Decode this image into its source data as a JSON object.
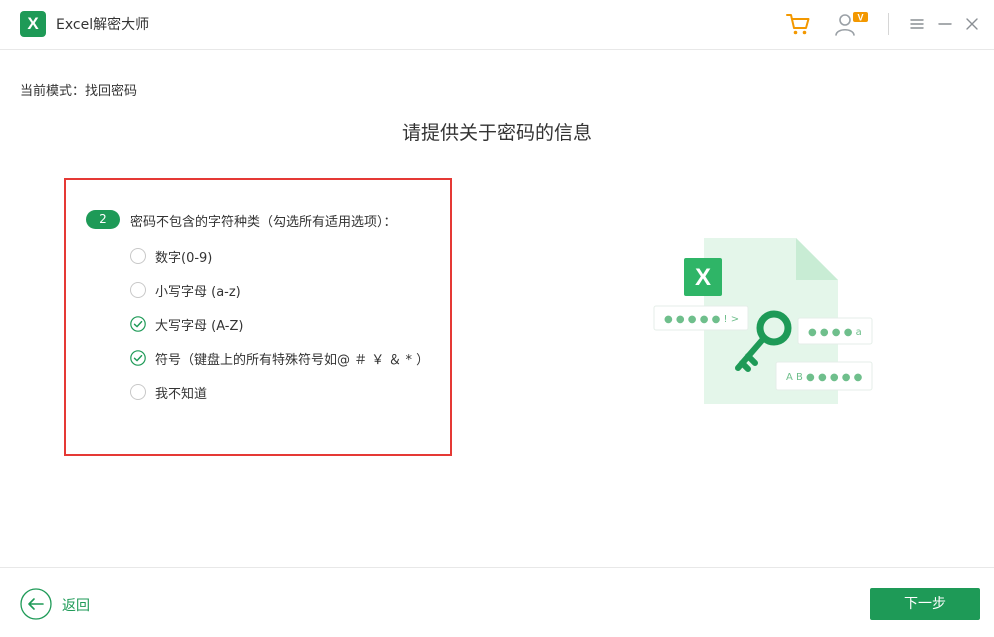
{
  "app": {
    "logo_letter": "X",
    "title": "Excel解密大师"
  },
  "titlebar": {
    "user_badge": "V"
  },
  "mode": {
    "label": "当前模式：找回密码"
  },
  "page": {
    "title": "请提供关于密码的信息"
  },
  "question": {
    "step": "2",
    "text": "密码不包含的字符种类（勾选所有适用选项）：",
    "options": [
      {
        "label": "数字(0-9)",
        "checked": false
      },
      {
        "label": "小写字母 (a-z)",
        "checked": false
      },
      {
        "label": "大写字母 (A-Z)",
        "checked": true
      },
      {
        "label": "符号（键盘上的所有特殊符号如@ ＃ ￥ ＆ * ）",
        "checked": true
      },
      {
        "label": "我不知道",
        "checked": false
      }
    ]
  },
  "illustration": {
    "doc_letter": "X",
    "card1": "● ● ● ● ●  ! >",
    "card2": "● ● ● ●  a",
    "card3": "A B ● ● ● ● ●"
  },
  "footer": {
    "back_label": "返回",
    "next_label": "下一步"
  },
  "colors": {
    "brand_green": "#1e9a57",
    "highlight_red": "#e53935",
    "cart_orange": "#f39800"
  }
}
